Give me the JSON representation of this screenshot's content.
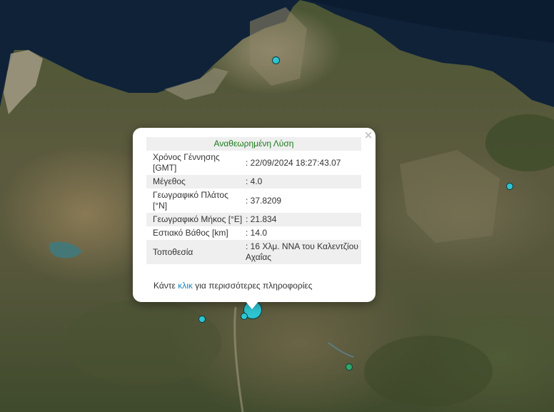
{
  "map": {
    "markers": [
      {
        "name": "quake-marker-north",
        "color": "#2ec4d2",
        "size": "small"
      },
      {
        "name": "quake-marker-east",
        "color": "#2ec4d2",
        "size": "small"
      },
      {
        "name": "quake-marker-selected",
        "color": "#2ec4d2",
        "size": "large"
      },
      {
        "name": "quake-marker-near-selected",
        "color": "#2ec4d2",
        "size": "small"
      },
      {
        "name": "quake-marker-west",
        "color": "#2ec4d2",
        "size": "small"
      },
      {
        "name": "quake-marker-south",
        "color": "#2ea86a",
        "size": "small"
      }
    ]
  },
  "popup": {
    "title": "Αναθεωρημένη Λύση",
    "close_glyph": "×",
    "rows": [
      {
        "label": "Χρόνος Γέννησης [GMT]",
        "value": ": 22/09/2024 18:27:43.07"
      },
      {
        "label": "Μέγεθος",
        "value": ": 4.0"
      },
      {
        "label": "Γεωγραφικό Πλάτος [°N]",
        "value": ": 37.8209"
      },
      {
        "label": "Γεωγραφικό Μήκος [°E]",
        "value": ": 21.834"
      },
      {
        "label": "Εστιακό Βάθος [km]",
        "value": ": 14.0"
      },
      {
        "label": "Τοποθεσία",
        "value": ": 16 Χλμ. ΝΝΑ του Καλεντζίου Αχαΐας"
      }
    ],
    "footer": {
      "prefix": "Κάντε",
      "link": "κλικ",
      "suffix": "για περισσότερες πληροφορίες"
    }
  }
}
